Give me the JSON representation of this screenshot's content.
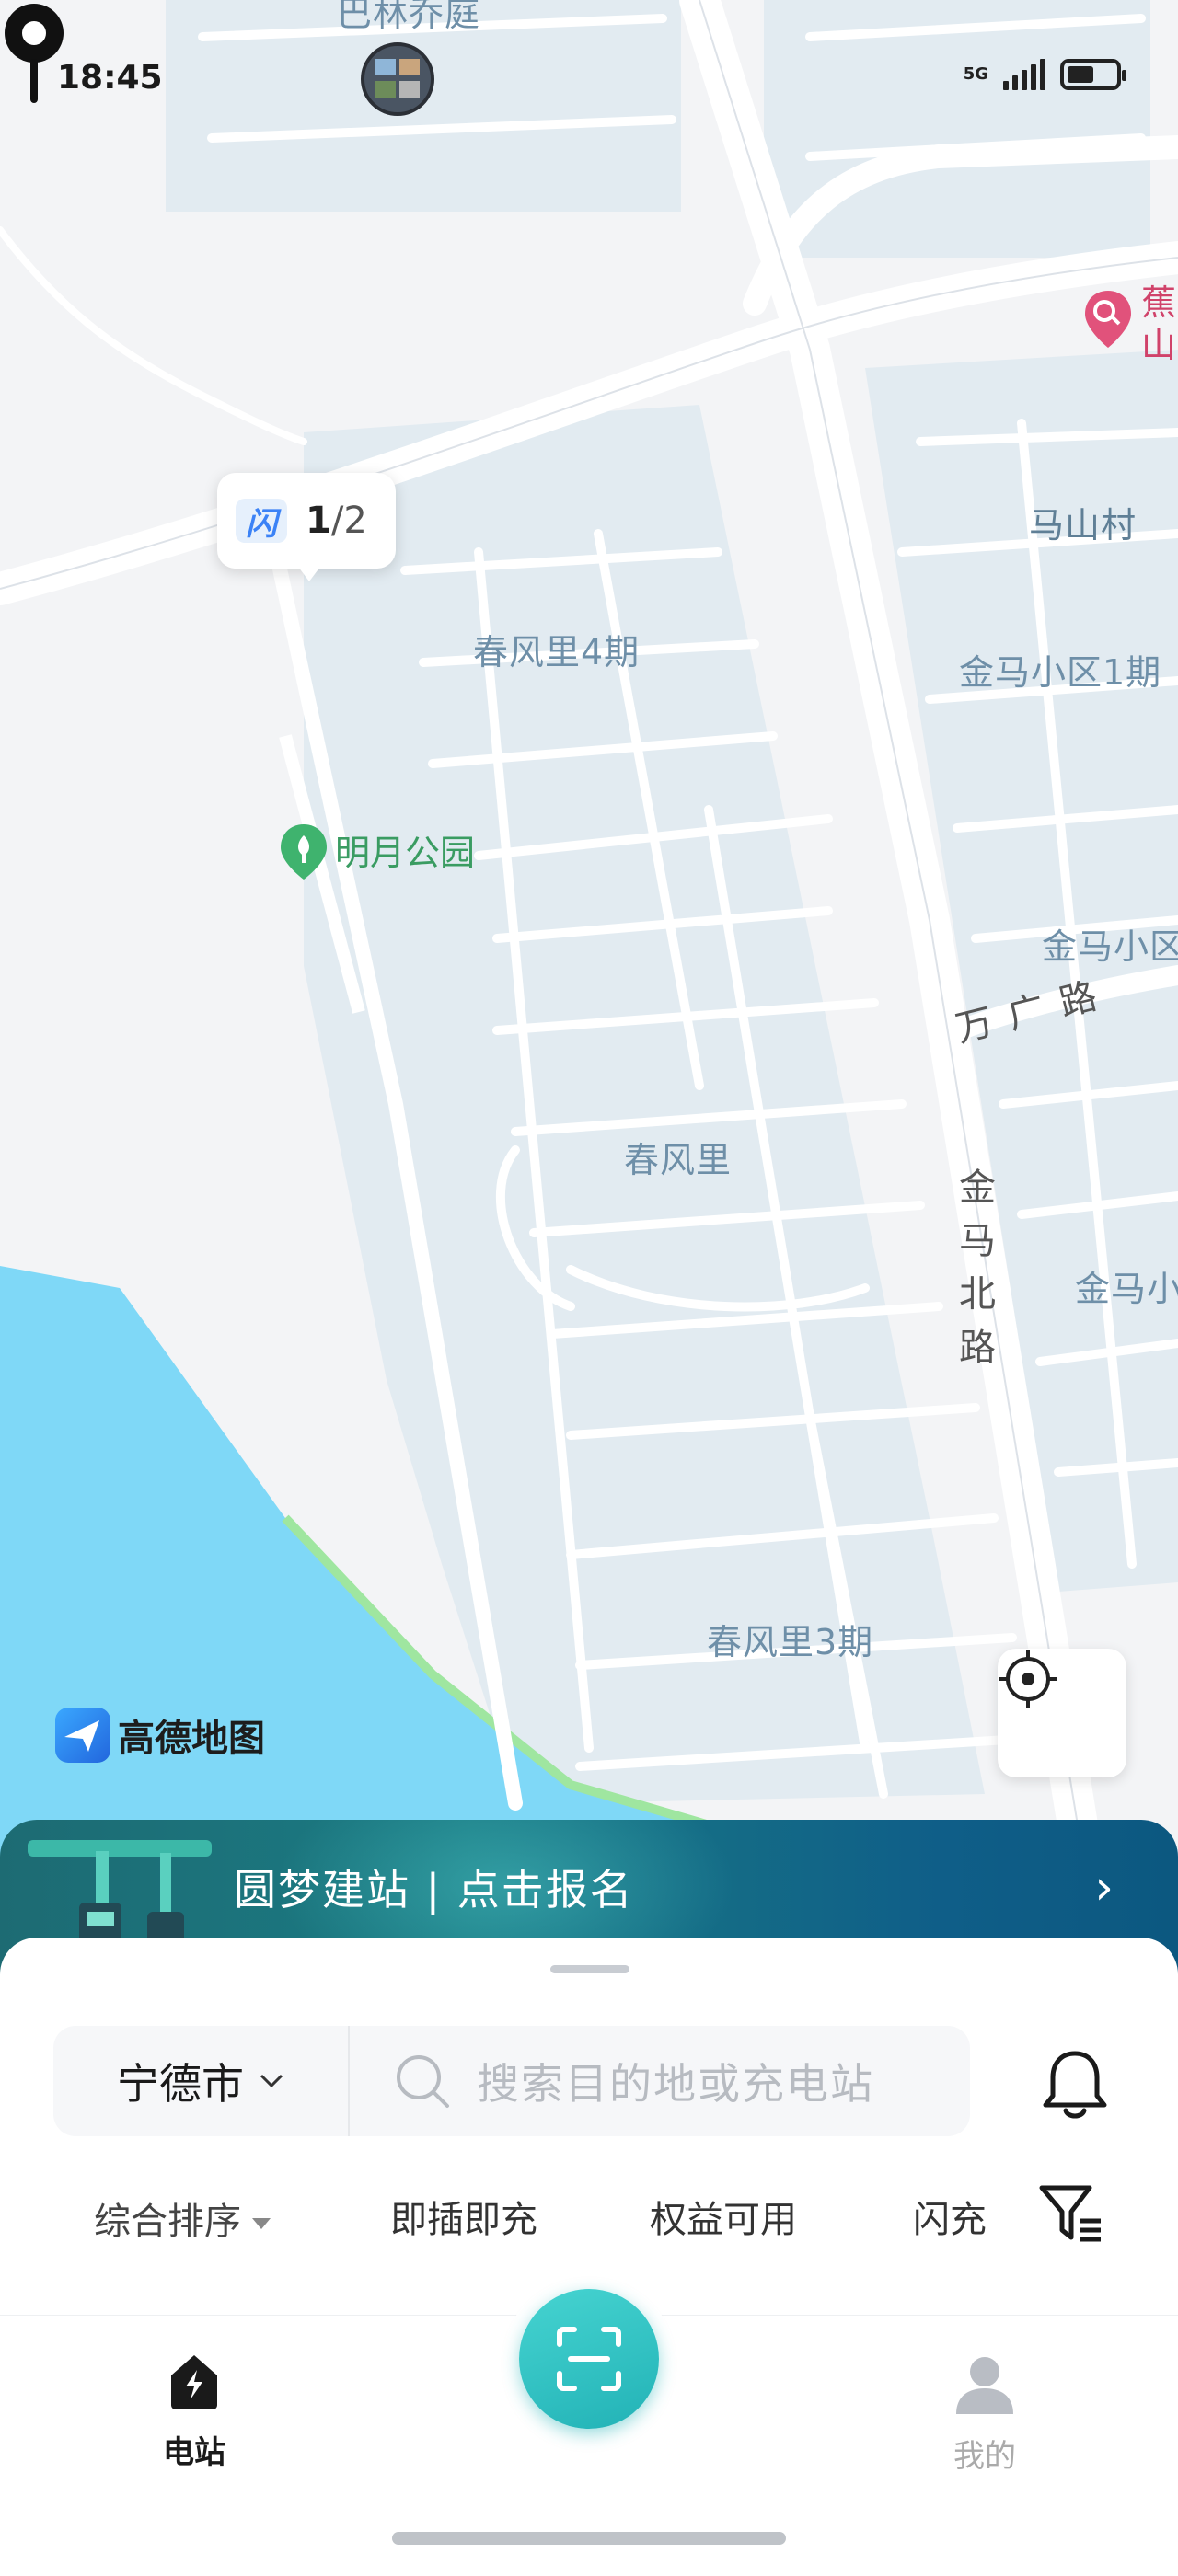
{
  "status_bar": {
    "time": "18:45",
    "network": "5G",
    "avatar": "avatar",
    "icons": [
      "signal-icon",
      "battery-icon"
    ]
  },
  "map": {
    "labels": {
      "area_north": "巴林乔庭",
      "chunfengli_4": "春风里4期",
      "chunfengli": "春风里",
      "chunfengli_3": "春风里3期",
      "mashan_village": "马山村",
      "jinma_1": "金马小区1期",
      "jinma_right": "金马小区",
      "jinma_right2": "金马小",
      "park": "明月公园",
      "poi_top_right": "蕉山",
      "road_wanguang": "万广路",
      "road_jinma_north": "金马北路"
    },
    "cluster_marker": {
      "brand": "闪",
      "count": "1",
      "total": "/2"
    },
    "provider_logo": "高德地图",
    "pin_icon": "location-pin-icon",
    "locate_icon": "crosshair-icon"
  },
  "banner": {
    "text": "圆梦建站 | 点击报名",
    "arrow": "›"
  },
  "sheet": {
    "city": "宁德市",
    "search_placeholder": "搜索目的地或充电站",
    "filters": {
      "sort": "综合排序",
      "instant": "即插即充",
      "benefits": "权益可用",
      "flash": "闪充"
    }
  },
  "tabs": {
    "station": "电站",
    "mine": "我的"
  },
  "colors": {
    "accent": "#22b2b6",
    "water": "#7fd8f7",
    "map_block": "#e2ebf1",
    "banner": "#1a7b84"
  }
}
